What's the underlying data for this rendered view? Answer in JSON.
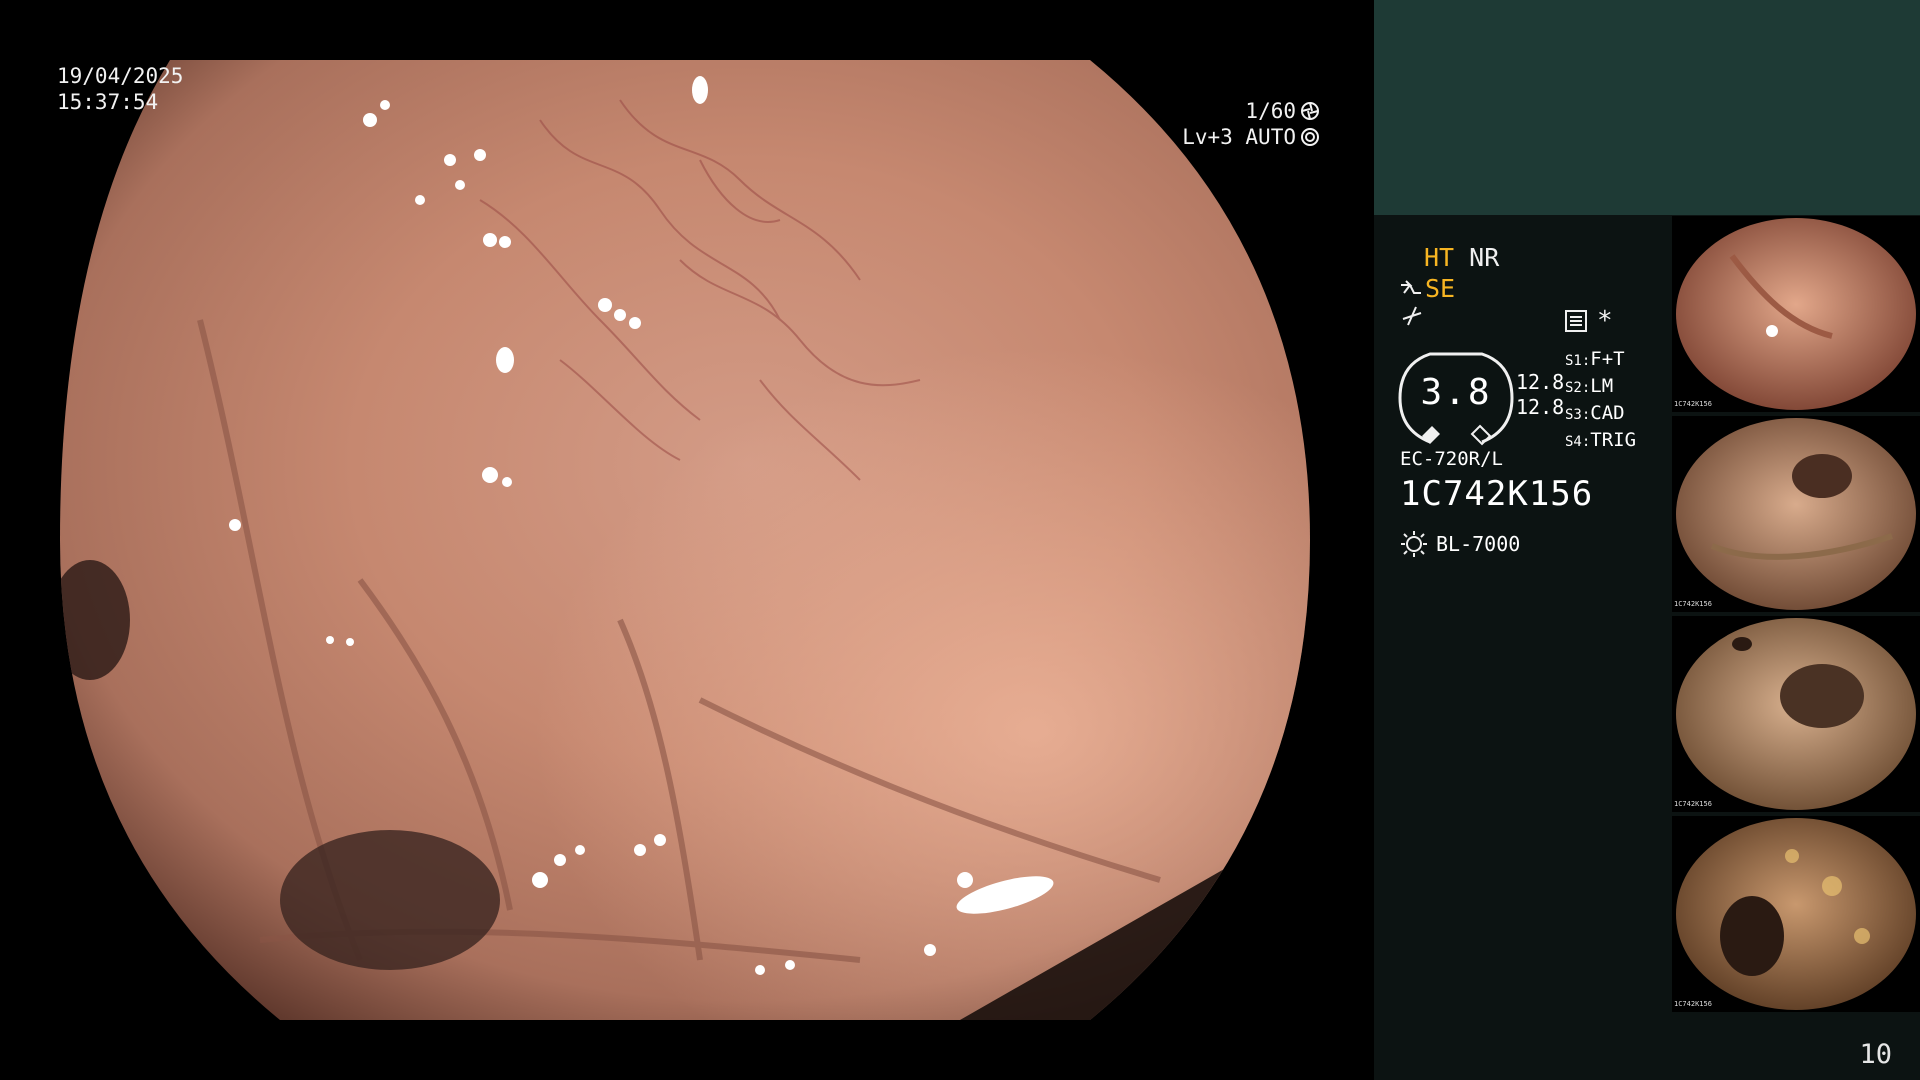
{
  "overlay": {
    "date": "19/04/2025",
    "time": "15:37:54",
    "shutter": "1/60",
    "iris": "Lv+3 AUTO"
  },
  "panel": {
    "flags": {
      "ht": "HT",
      "nr": "NR",
      "se": "SE"
    },
    "menu_asterisk": "*",
    "zoom_value": "3.8",
    "enhance_values": [
      "12.8",
      "12.8"
    ],
    "switches": [
      {
        "key": "S1:",
        "label": "F+T"
      },
      {
        "key": "S2:",
        "label": "LM"
      },
      {
        "key": "S3:",
        "label": "CAD"
      },
      {
        "key": "S4:",
        "label": "TRIG"
      }
    ],
    "scope_model": "EC-720R/L",
    "scope_serial": "1C742K156",
    "light_source": "BL-7000",
    "page_number": "10"
  },
  "thumbnails": [
    {
      "label": "1C742K156"
    },
    {
      "label": "1C742K156"
    },
    {
      "label": "1C742K156"
    },
    {
      "label": "1C742K156"
    }
  ],
  "colors": {
    "accent_yellow": "#f7b522",
    "panel_teal": "#1e3a35",
    "panel_dark": "#0c1312"
  }
}
